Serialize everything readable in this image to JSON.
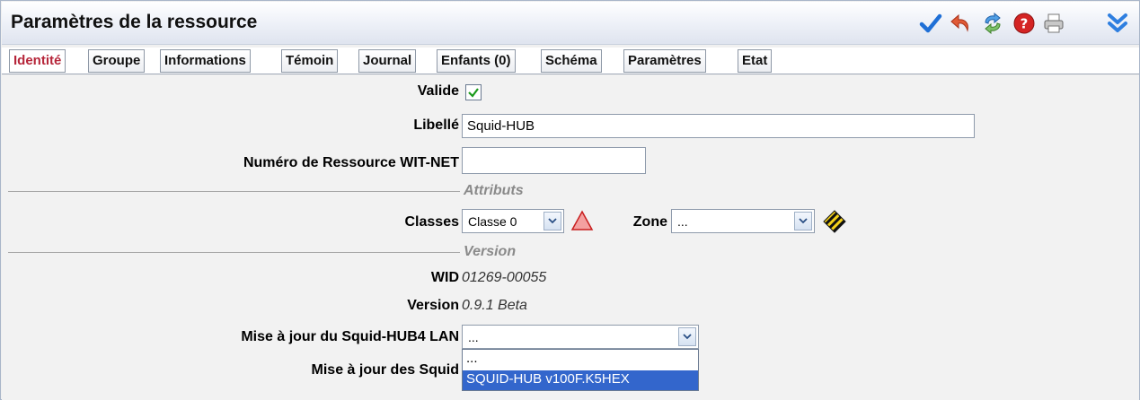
{
  "window": {
    "title": "Paramètres de la ressource"
  },
  "toolbar": {
    "icons": [
      "checkmark-icon",
      "undo-icon",
      "refresh-icon",
      "help-icon",
      "print-icon",
      "collapse-icon"
    ],
    "colors": {
      "check": "#1f6fd6",
      "undo": "#d9462e",
      "refresh": "#3f8fd6",
      "help": "#cc1f1f",
      "collapse": "#2f7fe0"
    }
  },
  "tabs": [
    {
      "label": "Identité",
      "active": true
    },
    {
      "label": "Groupe"
    },
    {
      "label": "Informations"
    },
    {
      "label": "Témoin"
    },
    {
      "label": "Journal"
    },
    {
      "label": "Enfants (0)"
    },
    {
      "label": "Schéma"
    },
    {
      "label": "Paramètres"
    },
    {
      "label": "Etat"
    }
  ],
  "form": {
    "valide_label": "Valide",
    "valide_checked": true,
    "libelle_label": "Libellé",
    "libelle_value": "Squid-HUB",
    "numero_label": "Numéro de Ressource WIT-NET",
    "numero_value": "",
    "attributs_section": "Attributs",
    "classes_label": "Classes",
    "classes_value": "Classe 0",
    "zone_label": "Zone",
    "zone_value": "...",
    "version_section": "Version",
    "wid_label": "WID",
    "wid_value": "01269-00055",
    "version_label": "Version",
    "version_value": "0.9.1 Beta",
    "maj_hub_label": "Mise à jour du Squid-HUB4 LAN",
    "maj_hub_value": "...",
    "maj_squid_label": "Mise à jour des Squid",
    "dropdown_options": [
      "...",
      "SQUID-HUB v100F.K5HEX"
    ],
    "dropdown_selected": "SQUID-HUB v100F.K5HEX"
  }
}
